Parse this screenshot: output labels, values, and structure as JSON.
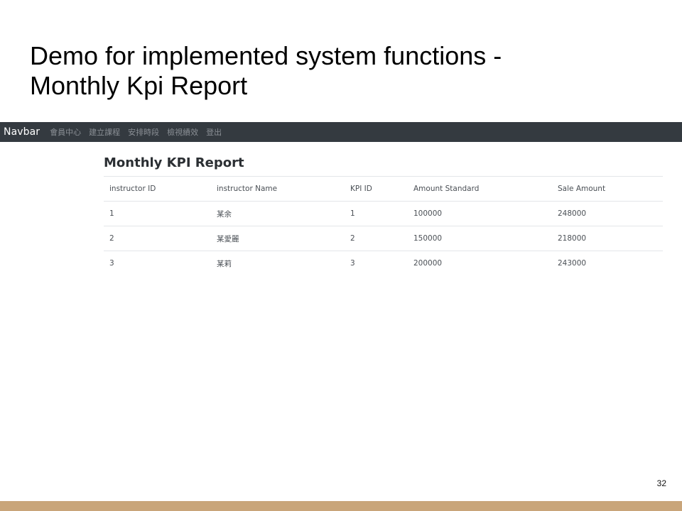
{
  "slide": {
    "title_line1": "Demo for implemented system functions -",
    "title_line2": "Monthly Kpi Report",
    "page_number": "32"
  },
  "navbar": {
    "brand": "Navbar",
    "links": [
      "會員中心",
      "建立課程",
      "安排時段",
      "檢視績效",
      "登出"
    ]
  },
  "report": {
    "title": "Monthly KPI Report",
    "columns": [
      "instructor ID",
      "instructor Name",
      "KPI ID",
      "Amount Standard",
      "Sale Amount"
    ],
    "rows": [
      [
        "1",
        "某余",
        "1",
        "100000",
        "248000"
      ],
      [
        "2",
        "某愛麗",
        "2",
        "150000",
        "218000"
      ],
      [
        "3",
        "某莉",
        "3",
        "200000",
        "243000"
      ]
    ]
  },
  "colors": {
    "navbar_bg": "#343a40",
    "bottom_bar": "#c9a57a"
  }
}
